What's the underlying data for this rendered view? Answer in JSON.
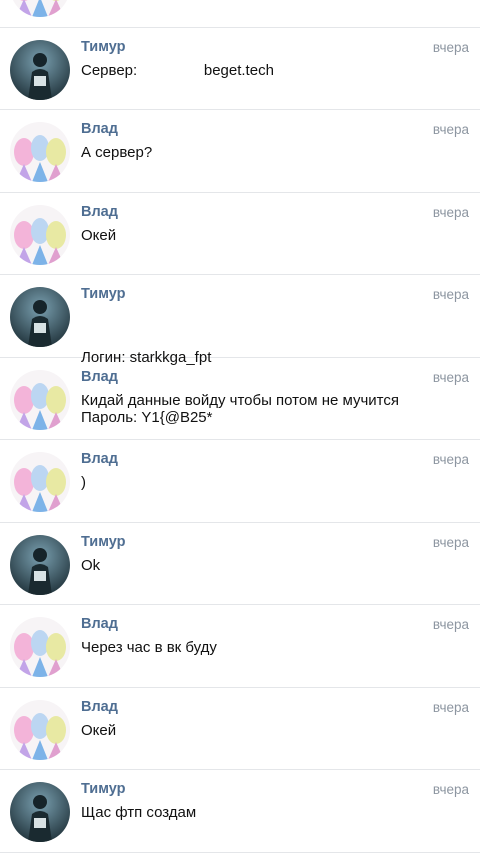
{
  "messages": [
    {
      "avatar": "vlad-avatar",
      "sender": "",
      "time": "",
      "lines": [
        ""
      ]
    },
    {
      "avatar": "timur-avatar",
      "sender": "Тимур",
      "time": "вчера",
      "lines": [
        "Сервер:                beget.tech"
      ]
    },
    {
      "avatar": "vlad-avatar",
      "sender": "Влад",
      "time": "вчера",
      "lines": [
        "А сервер?"
      ]
    },
    {
      "avatar": "vlad-avatar",
      "sender": "Влад",
      "time": "вчера",
      "lines": [
        "Окей"
      ]
    },
    {
      "avatar": "timur-avatar",
      "sender": "Тимур",
      "time": "вчера",
      "lines": [
        "Логин: starkkga_fpt",
        "Пароль: Y1{@B25*"
      ]
    },
    {
      "avatar": "vlad-avatar",
      "sender": "Влад",
      "time": "вчера",
      "lines": [
        "Кидай данные войду чтобы потом не мучится"
      ]
    },
    {
      "avatar": "vlad-avatar",
      "sender": "Влад",
      "time": "вчера",
      "lines": [
        ")"
      ]
    },
    {
      "avatar": "timur-avatar",
      "sender": "Тимур",
      "time": "вчера",
      "lines": [
        "Ok"
      ]
    },
    {
      "avatar": "vlad-avatar",
      "sender": "Влад",
      "time": "вчера",
      "lines": [
        "Через час в вк буду"
      ]
    },
    {
      "avatar": "vlad-avatar",
      "sender": "Влад",
      "time": "вчера",
      "lines": [
        "Окей"
      ]
    },
    {
      "avatar": "timur-avatar",
      "sender": "Тимур",
      "time": "вчера",
      "lines": [
        "Щас фтп создам"
      ]
    }
  ],
  "colors": {
    "sender_name": "#4f6e92",
    "timestamp": "#8d96a1",
    "message_text": "#111111",
    "divider": "#e4e6e9"
  }
}
